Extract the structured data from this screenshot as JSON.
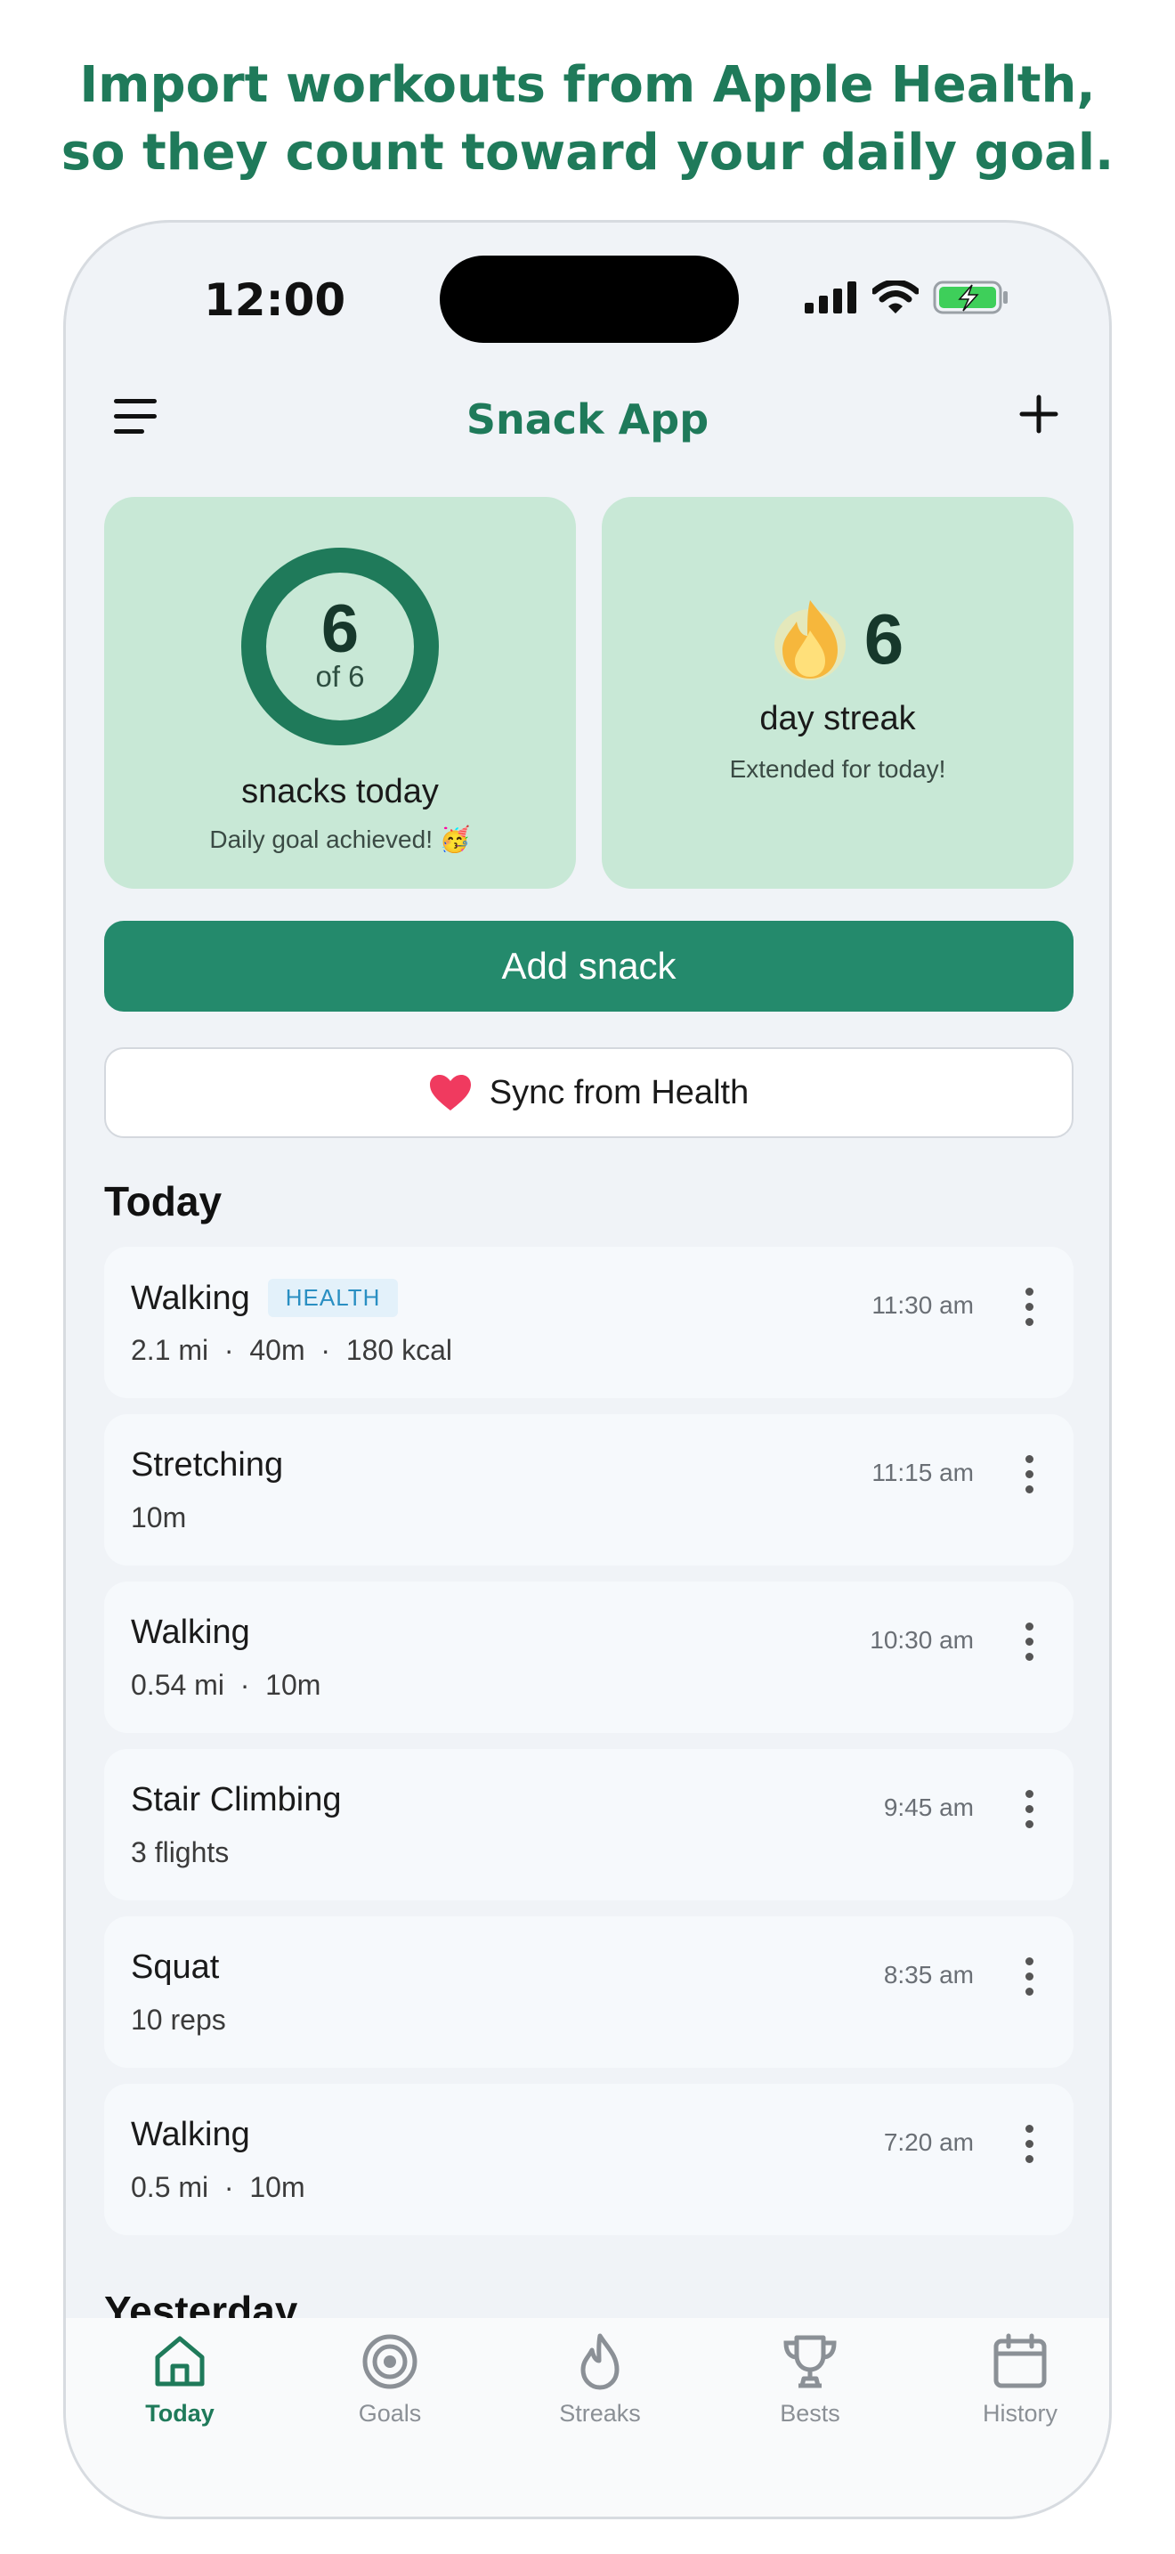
{
  "headline": {
    "line1": "Import workouts from Apple Health,",
    "line2": "so they count toward your daily goal."
  },
  "status_bar": {
    "time": "12:00"
  },
  "nav": {
    "title": "Snack App",
    "menu_icon": "hamburger-menu-icon",
    "add_icon": "plus-icon"
  },
  "snacks_card": {
    "count": "6",
    "of_label": "of 6",
    "progress": 1.0,
    "label": "snacks today",
    "sub": "Daily goal achieved! 🥳"
  },
  "streak_card": {
    "icon": "flame-emoji",
    "count": "6",
    "label": "day streak",
    "sub": "Extended for today!"
  },
  "actions": {
    "add_label": "Add snack",
    "sync_label": "Sync from Health",
    "sync_icon": "heart-icon"
  },
  "today": {
    "title": "Today",
    "items": [
      {
        "name": "Walking",
        "badge": "HEALTH",
        "detail": "2.1 mi  ·  40m  ·  180 kcal",
        "time": "11:30 am"
      },
      {
        "name": "Stretching",
        "badge": "",
        "detail": "10m",
        "time": "11:15 am"
      },
      {
        "name": "Walking",
        "badge": "",
        "detail": "0.54 mi  ·  10m",
        "time": "10:30 am"
      },
      {
        "name": "Stair Climbing",
        "badge": "",
        "detail": "3 flights",
        "time": "9:45 am"
      },
      {
        "name": "Squat",
        "badge": "",
        "detail": "10 reps",
        "time": "8:35 am"
      },
      {
        "name": "Walking",
        "badge": "",
        "detail": "0.5 mi  ·  10m",
        "time": "7:20 am"
      }
    ]
  },
  "yesterday": {
    "title": "Yesterday"
  },
  "tabs": [
    {
      "label": "Today",
      "icon": "home-icon",
      "active": true
    },
    {
      "label": "Goals",
      "icon": "target-icon",
      "active": false
    },
    {
      "label": "Streaks",
      "icon": "flame-icon",
      "active": false
    },
    {
      "label": "Bests",
      "icon": "trophy-icon",
      "active": false
    },
    {
      "label": "History",
      "icon": "calendar-icon",
      "active": false
    }
  ],
  "colors": {
    "brand": "#1f7a5a",
    "button": "#248a6c",
    "card": "#c8e8d6",
    "heart": "#f03a5f"
  }
}
